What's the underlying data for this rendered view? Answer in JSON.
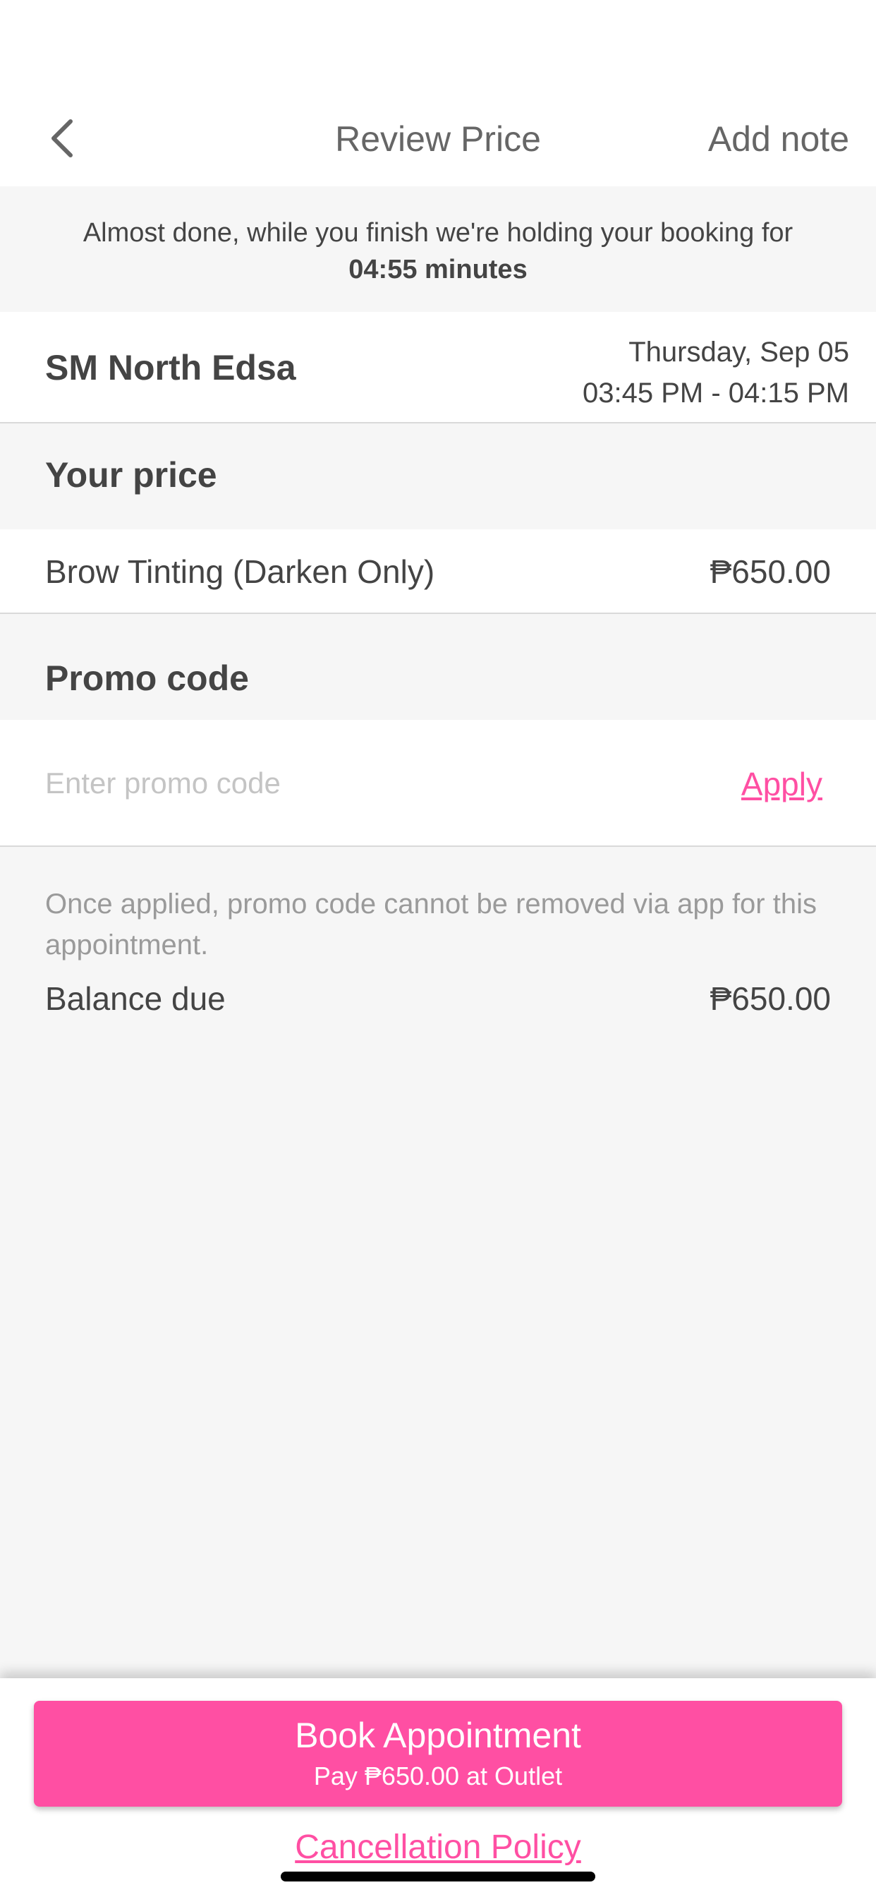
{
  "header": {
    "title": "Review Price",
    "add_note_label": "Add note",
    "back_icon": "chevron-left-icon"
  },
  "hold_banner": {
    "message": "Almost done, while you finish we're holding your booking for",
    "timer": "04:55 minutes"
  },
  "outlet": {
    "name": "SM North Edsa",
    "date": "Thursday, Sep 05",
    "time": "03:45 PM - 04:15 PM"
  },
  "price_section": {
    "heading": "Your price",
    "service": "Brow Tinting (Darken Only)",
    "amount": "₱650.00"
  },
  "promo_section": {
    "heading": "Promo code",
    "input_value": "",
    "input_placeholder": "Enter promo code",
    "apply_label": "Apply",
    "note": "Once applied, promo code cannot be removed via app for this appointment."
  },
  "balance": {
    "label": "Balance due",
    "amount": "₱650.00"
  },
  "footer": {
    "book_label": "Book Appointment",
    "book_sub": "Pay ₱650.00 at Outlet",
    "cancellation_label": "Cancellation Policy"
  },
  "colors": {
    "accent": "#ff4fa3",
    "background": "#f6f6f6",
    "text": "#444444"
  }
}
